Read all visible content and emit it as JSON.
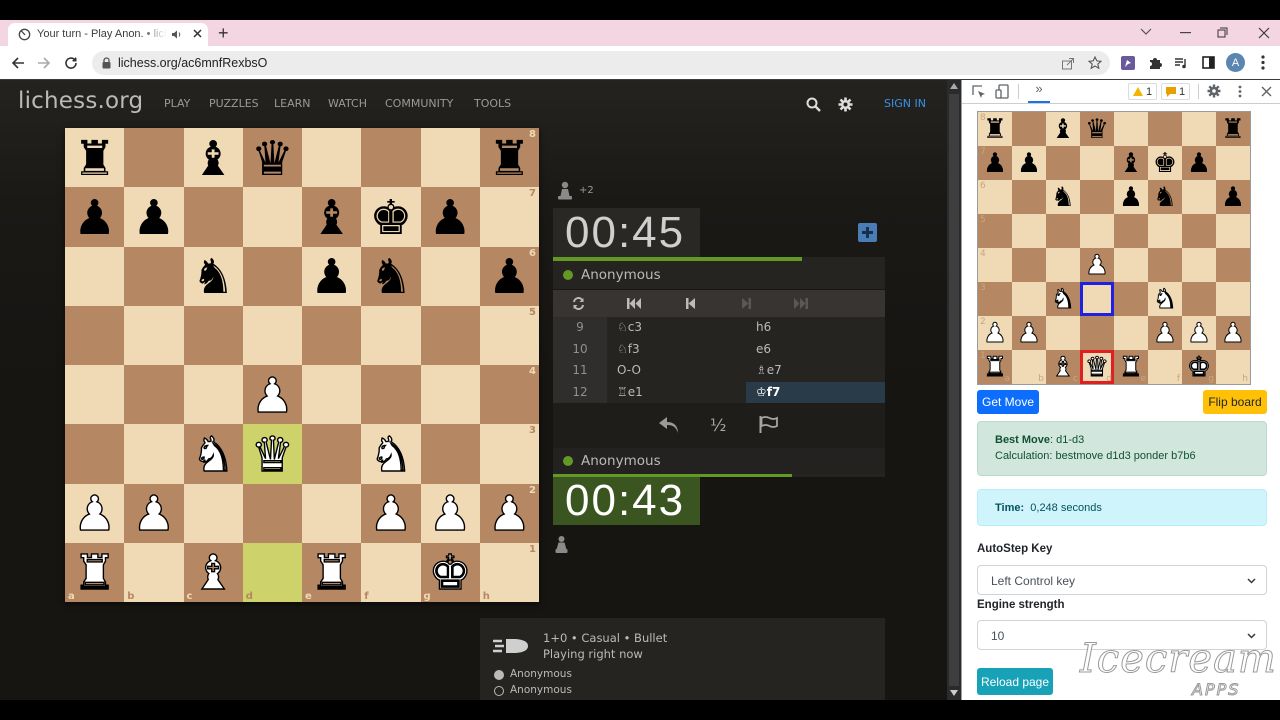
{
  "browser": {
    "tab_title": "Your turn - Play Anon. • liche",
    "new_tab_label": "+",
    "url": "lichess.org/ac6mnfRexbsO",
    "avatar_letter": "A",
    "icons": [
      "tab-favicon-icon",
      "speaker-icon",
      "tab-close-icon",
      "new-tab-icon",
      "tab-search-chevron-icon",
      "minimize-icon",
      "restore-icon",
      "window-close-icon",
      "back-icon",
      "forward-icon",
      "reload-icon",
      "lock-icon",
      "share-icon",
      "star-icon",
      "lichess-extension-icon",
      "extensions-puzzle-icon",
      "media-queue-icon",
      "side-panel-icon",
      "avatar",
      "kebab-menu-icon"
    ]
  },
  "site": {
    "logo": "lichess.org",
    "nav": [
      "PLAY",
      "PUZZLES",
      "LEARN",
      "WATCH",
      "COMMUNITY",
      "TOOLS"
    ],
    "sign_in": "SIGN IN"
  },
  "board": {
    "files": [
      "a",
      "b",
      "c",
      "d",
      "e",
      "f",
      "g",
      "h"
    ],
    "ranks": [
      "8",
      "7",
      "6",
      "5",
      "4",
      "3",
      "2",
      "1"
    ],
    "position": [
      [
        "bR",
        "",
        "bB",
        "bQ",
        "",
        "",
        "",
        "bR"
      ],
      [
        "bP",
        "bP",
        "",
        "",
        "bB",
        "bK",
        "bP",
        ""
      ],
      [
        "",
        "",
        "bN",
        "",
        "bP",
        "bN",
        "",
        "bP"
      ],
      [
        "",
        "",
        "",
        "",
        "",
        "",
        "",
        ""
      ],
      [
        "",
        "",
        "",
        "wP",
        "",
        "",
        "",
        ""
      ],
      [
        "",
        "",
        "wN",
        "wQ",
        "",
        "wN",
        "",
        ""
      ],
      [
        "wP",
        "wP",
        "",
        "",
        "",
        "wP",
        "wP",
        "wP"
      ],
      [
        "wR",
        "",
        "wB",
        "",
        "wR",
        "",
        "wK",
        ""
      ]
    ],
    "last_move": [
      "d1",
      "d3"
    ],
    "colors": {
      "light": "#f0d9b5",
      "dark": "#b58863",
      "highlight_light": "#cdd26a",
      "highlight_dark": "#c2c05a"
    }
  },
  "game": {
    "top": {
      "material_diff": "+2",
      "clock": "00:45",
      "player": "Anonymous",
      "time_fraction": 0.75
    },
    "bottom": {
      "clock": "00:43",
      "player": "Anonymous",
      "time_fraction": 0.72
    },
    "moves": [
      {
        "num": "9",
        "white": "♘c3",
        "black": "h6"
      },
      {
        "num": "10",
        "white": "♘f3",
        "black": "e6"
      },
      {
        "num": "11",
        "white": "O-O",
        "black": "♗e7"
      },
      {
        "num": "12",
        "white": "♖e1",
        "black": "♔f7"
      }
    ],
    "active_move": "♔f7",
    "draw_label": "½",
    "info": {
      "mode": "1+0 • Casual • Bullet",
      "status": "Playing right now",
      "players": [
        "Anonymous",
        "Anonymous"
      ]
    },
    "accent_green": "#629924"
  },
  "devtools": {
    "more_tabs": "»",
    "warnings_count": "1",
    "issues_count": "1"
  },
  "extension": {
    "board_position": [
      [
        "bR",
        "",
        "bB",
        "bQ",
        "",
        "",
        "",
        "bR"
      ],
      [
        "bP",
        "bP",
        "",
        "",
        "bB",
        "bK",
        "bP",
        ""
      ],
      [
        "",
        "",
        "bN",
        "",
        "bP",
        "bN",
        "",
        "bP"
      ],
      [
        "",
        "",
        "",
        "",
        "",
        "",
        "",
        ""
      ],
      [
        "",
        "",
        "",
        "wP",
        "",
        "",
        "",
        ""
      ],
      [
        "",
        "",
        "wN",
        "",
        "",
        "wN",
        "",
        ""
      ],
      [
        "wP",
        "wP",
        "",
        "",
        "",
        "wP",
        "wP",
        "wP"
      ],
      [
        "wR",
        "",
        "wB",
        "wQ",
        "wR",
        "",
        "wK",
        ""
      ]
    ],
    "suggest_from": "d1",
    "suggest_to": "d3",
    "get_move": "Get Move",
    "flip_board": "Flip board",
    "best_move_label": "Best Move",
    "best_move_value": ": d1-d3",
    "calculation": "Calculation: bestmove d1d3 ponder b7b6",
    "time_label": "Time:",
    "time_value": "0,248 seconds",
    "autostep_label": "AutoStep Key",
    "autostep_value": "Left Control key",
    "strength_label": "Engine strength",
    "strength_value": "10",
    "reload": "Reload page",
    "colors": {
      "primary": "#0d6efd",
      "warning": "#ffc107",
      "success_bg": "#d1e7dd",
      "info_bg": "#cff4fc",
      "teal": "#17a2b8"
    }
  },
  "watermark": {
    "brand": "Icecream",
    "sub": "APPS"
  }
}
